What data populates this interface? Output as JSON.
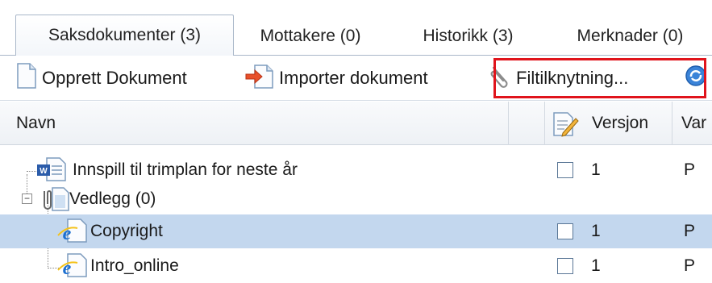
{
  "tabs": [
    {
      "label": "Saksdokumenter (3)",
      "active": true
    },
    {
      "label": "Mottakere (0)",
      "active": false
    },
    {
      "label": "Historikk (3)",
      "active": false
    },
    {
      "label": "Merknader (0)",
      "active": false
    }
  ],
  "toolbar": {
    "create_label": "Opprett Dokument",
    "import_label": "Importer dokument",
    "link_label": "Filtilknytning..."
  },
  "grid": {
    "columns": {
      "name": "Navn",
      "version": "Versjon",
      "variant": "Var"
    },
    "rows": [
      {
        "name": "Innspill til trimplan for neste år",
        "version": "1",
        "variant": "P",
        "icon": "word-document-icon",
        "selected": false
      },
      {
        "name": "Vedlegg (0)",
        "version": "",
        "variant": "",
        "icon": "attachment-icon",
        "selected": false
      },
      {
        "name": "Copyright",
        "version": "1",
        "variant": "P",
        "icon": "ie-document-icon",
        "selected": true
      },
      {
        "name": "Intro_online",
        "version": "1",
        "variant": "P",
        "icon": "ie-document-icon",
        "selected": false
      }
    ]
  },
  "colors": {
    "selection": "#c3d7ee",
    "highlight_box": "#e0141c",
    "tab_border": "#a9b7c9"
  }
}
